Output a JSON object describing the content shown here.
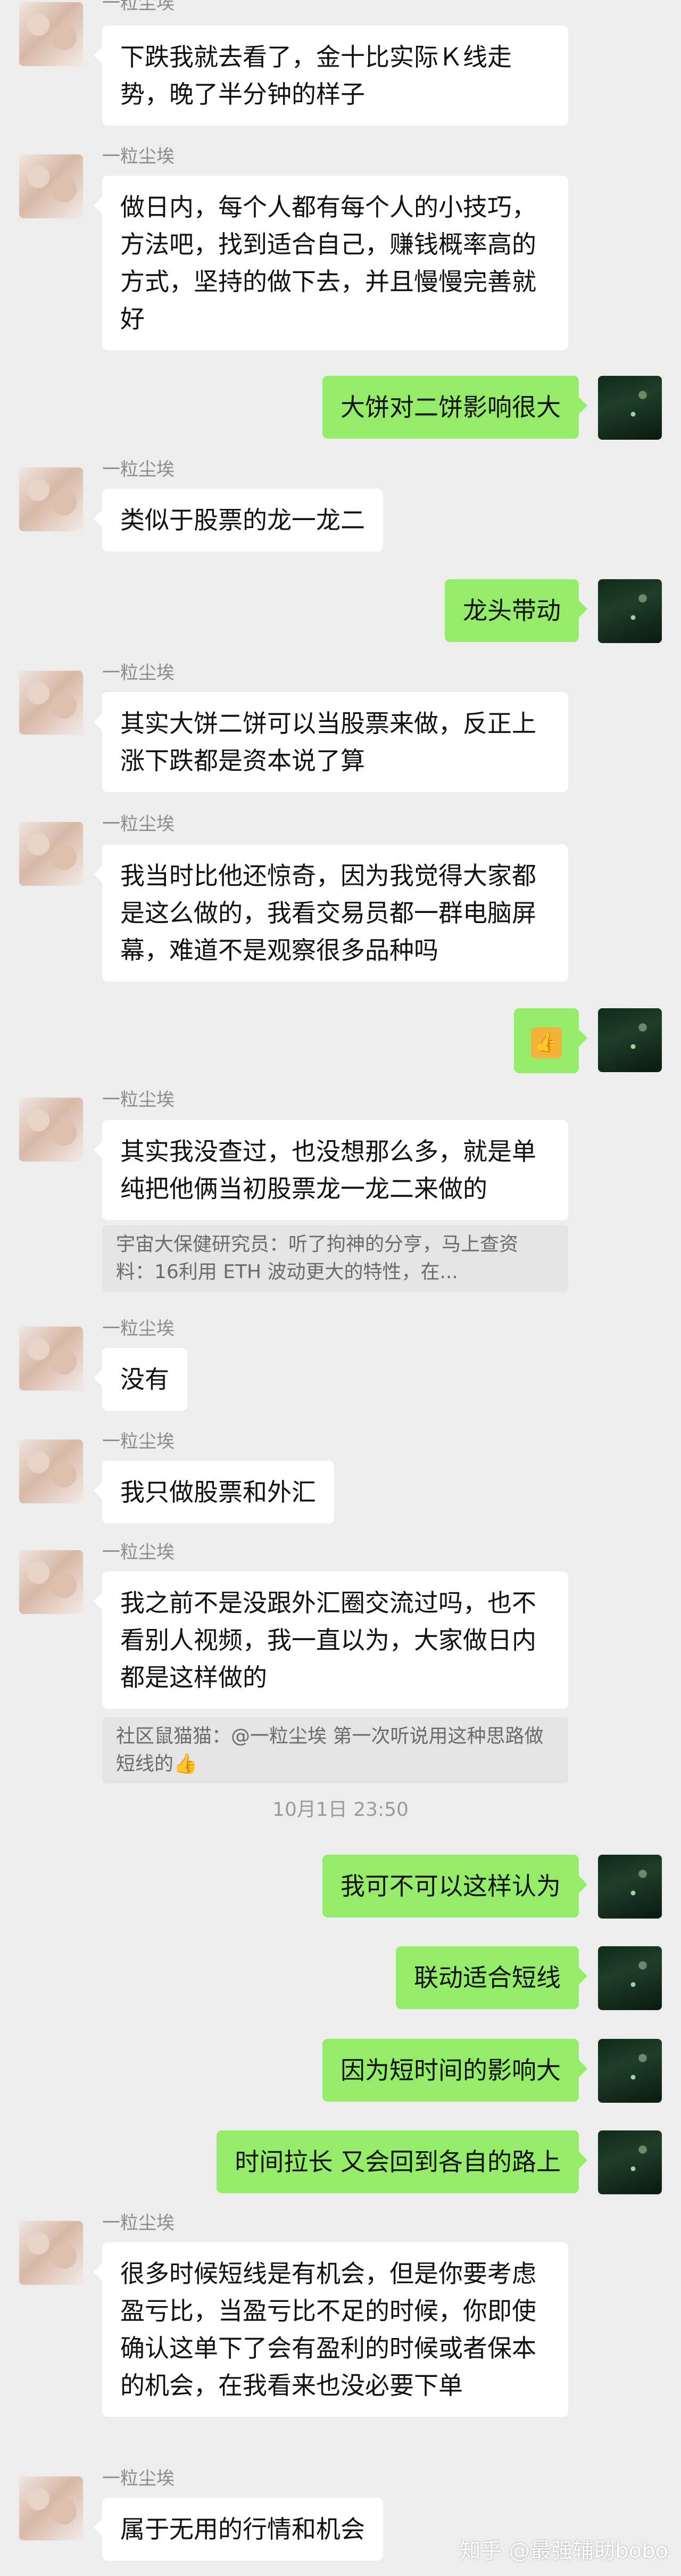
{
  "contact": {
    "name": "一粒尘埃"
  },
  "messages": [
    {
      "text": "下跌我就去看了，金十比实际Ｋ线走势，晚了半分钟的样子"
    },
    {
      "text": "做日内，每个人都有每个人的小技巧，方法吧，找到适合自己，赚钱概率高的方式，坚持的做下去，并且慢慢完善就好"
    },
    {
      "text": "大饼对二饼影响很大"
    },
    {
      "text": "类似于股票的龙一龙二"
    },
    {
      "text": "龙头带动"
    },
    {
      "text": "其实大饼二饼可以当股票来做，反正上涨下跌都是资本说了算"
    },
    {
      "text": "我当时比他还惊奇，因为我觉得大家都是这么做的，我看交易员都一群电脑屏幕，难道不是观察很多品种吗"
    },
    {
      "text": "👍"
    },
    {
      "text": "其实我没查过，也没想那么多，就是单纯把他俩当初股票龙一龙二来做的",
      "quote": "宇宙大保健研究员：听了拘神的分亨，马上查资料：16利用 ETH 波动更大的特性，在..."
    },
    {
      "text": "没有"
    },
    {
      "text": "我只做股票和外汇"
    },
    {
      "text": "我之前不是没跟外汇圈交流过吗，也不看别人视频，我一直以为，大家做日内都是这样做的",
      "quote": "社区鼠猫猫：@一粒尘埃 第一次听说用这种思路做短线的👍"
    },
    {
      "timestamp": "10月1日 23:50"
    },
    {
      "text": "我可不可以这样认为"
    },
    {
      "text": "联动适合短线"
    },
    {
      "text": "因为短时间的影响大"
    },
    {
      "text": "时间拉长 又会回到各自的路上"
    },
    {
      "text": "很多时候短线是有机会，但是你要考虑盈亏比，当盈亏比不足的时候，你即使确认这单下了会有盈利的时候或者保本的机会，在我看来也没必要下单"
    },
    {
      "text": "属于无用的行情和机会"
    }
  ],
  "watermark": "知乎 @最强辅助bobo",
  "colors": {
    "sent_bubble": "#95ec69",
    "received_bubble": "#ffffff",
    "background": "#ededed"
  }
}
